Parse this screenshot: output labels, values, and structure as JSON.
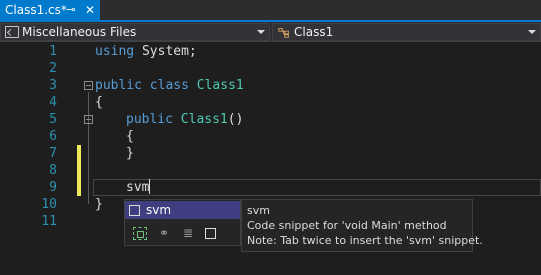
{
  "tab": {
    "title": "Class1.cs*",
    "pin_glyph": "⊸",
    "close_glyph": "✕"
  },
  "navbar": {
    "project": "Miscellaneous Files",
    "type": "Class1"
  },
  "editor": {
    "lines": [
      {
        "num": "1"
      },
      {
        "num": "2"
      },
      {
        "num": "3"
      },
      {
        "num": "4"
      },
      {
        "num": "5"
      },
      {
        "num": "6"
      },
      {
        "num": "7"
      },
      {
        "num": "8"
      },
      {
        "num": "9"
      },
      {
        "num": "10"
      },
      {
        "num": "11"
      }
    ],
    "tokens": {
      "using": "using",
      "system": "System;",
      "public1": "public",
      "class": "class",
      "class1a": "Class1",
      "open1": "{",
      "public2": "public",
      "class1b": "Class1",
      "parens": "()",
      "open2": "{",
      "close2": "}",
      "typed": "svm",
      "close1": "}"
    }
  },
  "completion": {
    "item_label": "svm"
  },
  "tooltip": {
    "title": "svm",
    "description": "Code snippet for 'void Main' method",
    "note": "Note: Tab twice to insert the 'svm' snippet."
  },
  "colors": {
    "accent": "#007acc",
    "keyword": "#569cd6",
    "type": "#4ec9b0",
    "method": "#dcdcaa",
    "line_number": "#2b91af",
    "change_marker": "#efe85b",
    "selection": "#3e3e80"
  },
  "icons": {
    "tab_pin": "pin-icon",
    "tab_close": "close-icon",
    "project": "csharp-project-icon",
    "type": "class-icon",
    "snippet": "snippet-icon"
  }
}
